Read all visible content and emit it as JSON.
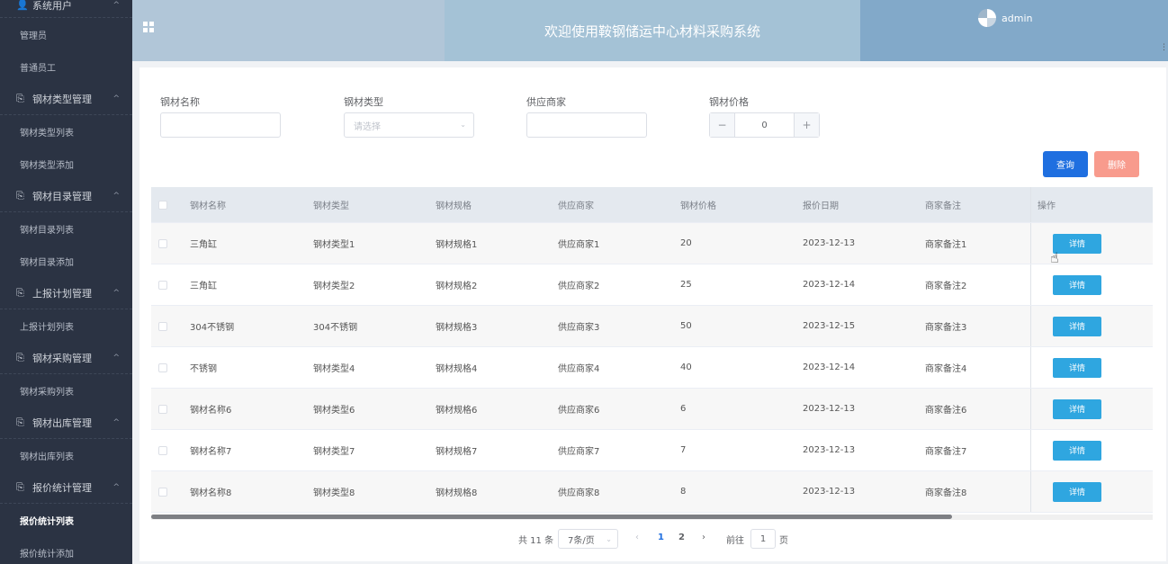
{
  "sidebar": {
    "groups": [
      {
        "icon": "user-icon",
        "label": "系统用户",
        "items": [
          "管理员",
          "普通员工"
        ]
      },
      {
        "icon": "doc-icon",
        "label": "钢材类型管理",
        "items": [
          "钢材类型列表",
          "钢材类型添加"
        ]
      },
      {
        "icon": "doc-icon",
        "label": "钢材目录管理",
        "items": [
          "钢材目录列表",
          "钢材目录添加"
        ]
      },
      {
        "icon": "doc-icon",
        "label": "上报计划管理",
        "items": [
          "上报计划列表"
        ]
      },
      {
        "icon": "doc-icon",
        "label": "钢材采购管理",
        "items": [
          "钢材采购列表"
        ]
      },
      {
        "icon": "doc-icon",
        "label": "钢材出库管理",
        "items": [
          "钢材出库列表"
        ]
      },
      {
        "icon": "doc-icon",
        "label": "报价统计管理",
        "items": [
          "报价统计列表",
          "报价统计添加"
        ]
      }
    ],
    "active_item": "报价统计列表"
  },
  "header": {
    "title": "欢迎使用鞍钢储运中心材料采购系统",
    "username": "admin"
  },
  "filters": {
    "name_label": "钢材名称",
    "type_label": "钢材类型",
    "type_placeholder": "请选择",
    "supplier_label": "供应商家",
    "price_label": "钢材价格",
    "price_value": "0",
    "minus": "−",
    "plus": "+",
    "query_button": "查询",
    "delete_button": "删除"
  },
  "table": {
    "columns": [
      "钢材名称",
      "钢材类型",
      "钢材规格",
      "供应商家",
      "钢材价格",
      "报价日期",
      "商家备注",
      "操作"
    ],
    "detail_label": "详情",
    "rows": [
      [
        "三角缸",
        "钢材类型1",
        "钢材规格1",
        "供应商家1",
        "20",
        "2023-12-13",
        "商家备注1"
      ],
      [
        "三角缸",
        "钢材类型2",
        "钢材规格2",
        "供应商家2",
        "25",
        "2023-12-14",
        "商家备注2"
      ],
      [
        "304不锈钢",
        "304不锈钢",
        "钢材规格3",
        "供应商家3",
        "50",
        "2023-12-15",
        "商家备注3"
      ],
      [
        "不锈钢",
        "钢材类型4",
        "钢材规格4",
        "供应商家4",
        "40",
        "2023-12-14",
        "商家备注4"
      ],
      [
        "钢材名称6",
        "钢材类型6",
        "钢材规格6",
        "供应商家6",
        "6",
        "2023-12-13",
        "商家备注6"
      ],
      [
        "钢材名称7",
        "钢材类型7",
        "钢材规格7",
        "供应商家7",
        "7",
        "2023-12-13",
        "商家备注7"
      ],
      [
        "钢材名称8",
        "钢材类型8",
        "钢材规格8",
        "供应商家8",
        "8",
        "2023-12-13",
        "商家备注8"
      ]
    ]
  },
  "pagination": {
    "total": "共 11 条",
    "page_size": "7条/页",
    "prev": "‹",
    "pages": [
      "1",
      "2"
    ],
    "current_page": "1",
    "next": "›",
    "goto_label": "前往",
    "goto_value": "1",
    "goto_suffix": "页"
  },
  "colors": {
    "sidebar_bg": "#2b3343",
    "query": "#1f6fe0",
    "delete": "#f89b8d",
    "detail": "#2fa6e0",
    "active_page": "#1f6fe0"
  }
}
